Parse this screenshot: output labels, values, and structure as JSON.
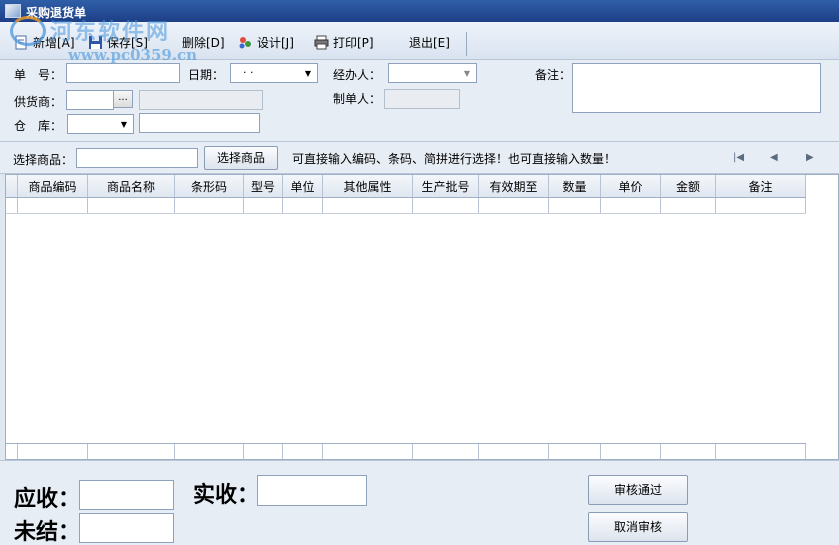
{
  "window": {
    "title": "采购退货单"
  },
  "watermark": {
    "site": "河东软件网",
    "url": "www.pc0359.cn"
  },
  "toolbar": {
    "new_label": "新增[A]",
    "save_label": "保存[S]",
    "delete_label": "删除[D]",
    "design_label": "设计[J]",
    "print_label": "打印[P]",
    "exit_label": "退出[E]"
  },
  "form": {
    "order_no_label": "单　号：",
    "date_label": "日期：",
    "date_value": "· ·",
    "handler_label": "经办人：",
    "remark_label": "备注：",
    "supplier_label": "供货商：",
    "supplier_button": "...",
    "creator_label": "制单人：",
    "warehouse_label": "仓　库："
  },
  "select_bar": {
    "label": "选择商品：",
    "button": "选择商品",
    "hint": "可直接输入编码、条码、简拼进行选择！也可直接输入数量！",
    "nav_first": "|◀",
    "nav_prev": "◀",
    "nav_next": "▶"
  },
  "grid": {
    "columns": [
      "商品编码",
      "商品名称",
      "条形码",
      "型号",
      "单位",
      "其他属性",
      "生产批号",
      "有效期至",
      "数量",
      "单价",
      "金额",
      "备注"
    ]
  },
  "bottom": {
    "receivable_label": "应收：",
    "received_label": "实收：",
    "unsettled_label": "未结：",
    "approve_button": "审核通过",
    "cancel_approve_button": "取消审核"
  },
  "colors": {
    "title_bar": "#1d3f86",
    "panel": "#e7edf5",
    "border": "#8ea2be"
  }
}
